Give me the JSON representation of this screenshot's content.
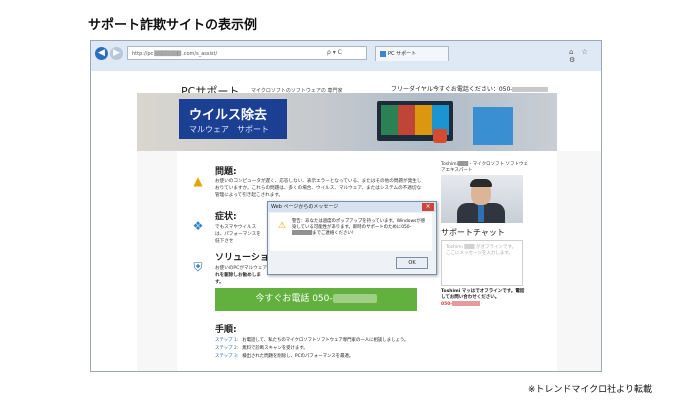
{
  "caption": {
    "title": "サポート詐欺サイトの表示例",
    "credit": "※トレンドマイクロ社より転載"
  },
  "browser": {
    "url": "http://pc ▒▒▒▒▒▒▒ .com/s_assist/",
    "address_icons": "ρ ▾ C",
    "tab_label": "PC サポート",
    "tools": "⌂ ☆ ⚙"
  },
  "site": {
    "logo": "PCサポート",
    "logo_sub": "マイクロソフトのソフトウェアの 専門家",
    "freedial": "フリーダイヤル今すぐお電話ください：050-",
    "banner_title": "ウイルス除去",
    "banner_sub": "マルウェア　サポート",
    "sections": [
      {
        "heading": "問題:",
        "text": "お使いのコンピュータが遅く、応答しない、表示エラーとなっている、またはその他の問題が発生しおりていますか。これらの問題は、多くの場合、ウイルス、マルウェア、またはシステムの不適切な管理によって引き起こされます。",
        "icon": "warning-icon"
      },
      {
        "heading": "症状:",
        "text": "でもスマやウイルスは、パフォーマンスを低下させ",
        "icon": "windows-icon"
      },
      {
        "heading": "ソリューショ",
        "text": "お使いのPCがマルウェア",
        "text_bold": "れを駆除しお勧めします。",
        "icon": "shield-icon"
      }
    ],
    "call_button": "今すぐお電話 050-",
    "steps_heading": "手順:",
    "steps": [
      {
        "label": "ステップ 1:",
        "text": "お電話して、私たちのマイクロソフトソフトウェア専門家の一人に相談しましょう。"
      },
      {
        "label": "ステップ 2:",
        "text": "無料で診断スキャンを受けます。"
      },
      {
        "label": "ステップ 3:",
        "text": "検出された問題を削除し、PCのパフォーマンスを最適。"
      }
    ]
  },
  "sidebar": {
    "profile": "Toshimi▒▒▒ - マイクロソフト ソフトウェアエキスパート",
    "chat_title": "サポートチャット",
    "chat_placeholder": "Toshimi ▒▒▒ がオフラインです。ここにメッセージを入力します。",
    "offline_text": "Toshimi マッはでオフラインです。電話してお問い合わせください。",
    "offline_number": "050-"
  },
  "dialog": {
    "title": "Web ページからのメッセージ",
    "close": "×",
    "message": "警告：あなたは過度のポップアップを持っています。Windowsが感染している可能性があります。即時のサポートのために050-▒▒▒▒▒▒までご連絡ください！",
    "ok": "OK"
  }
}
